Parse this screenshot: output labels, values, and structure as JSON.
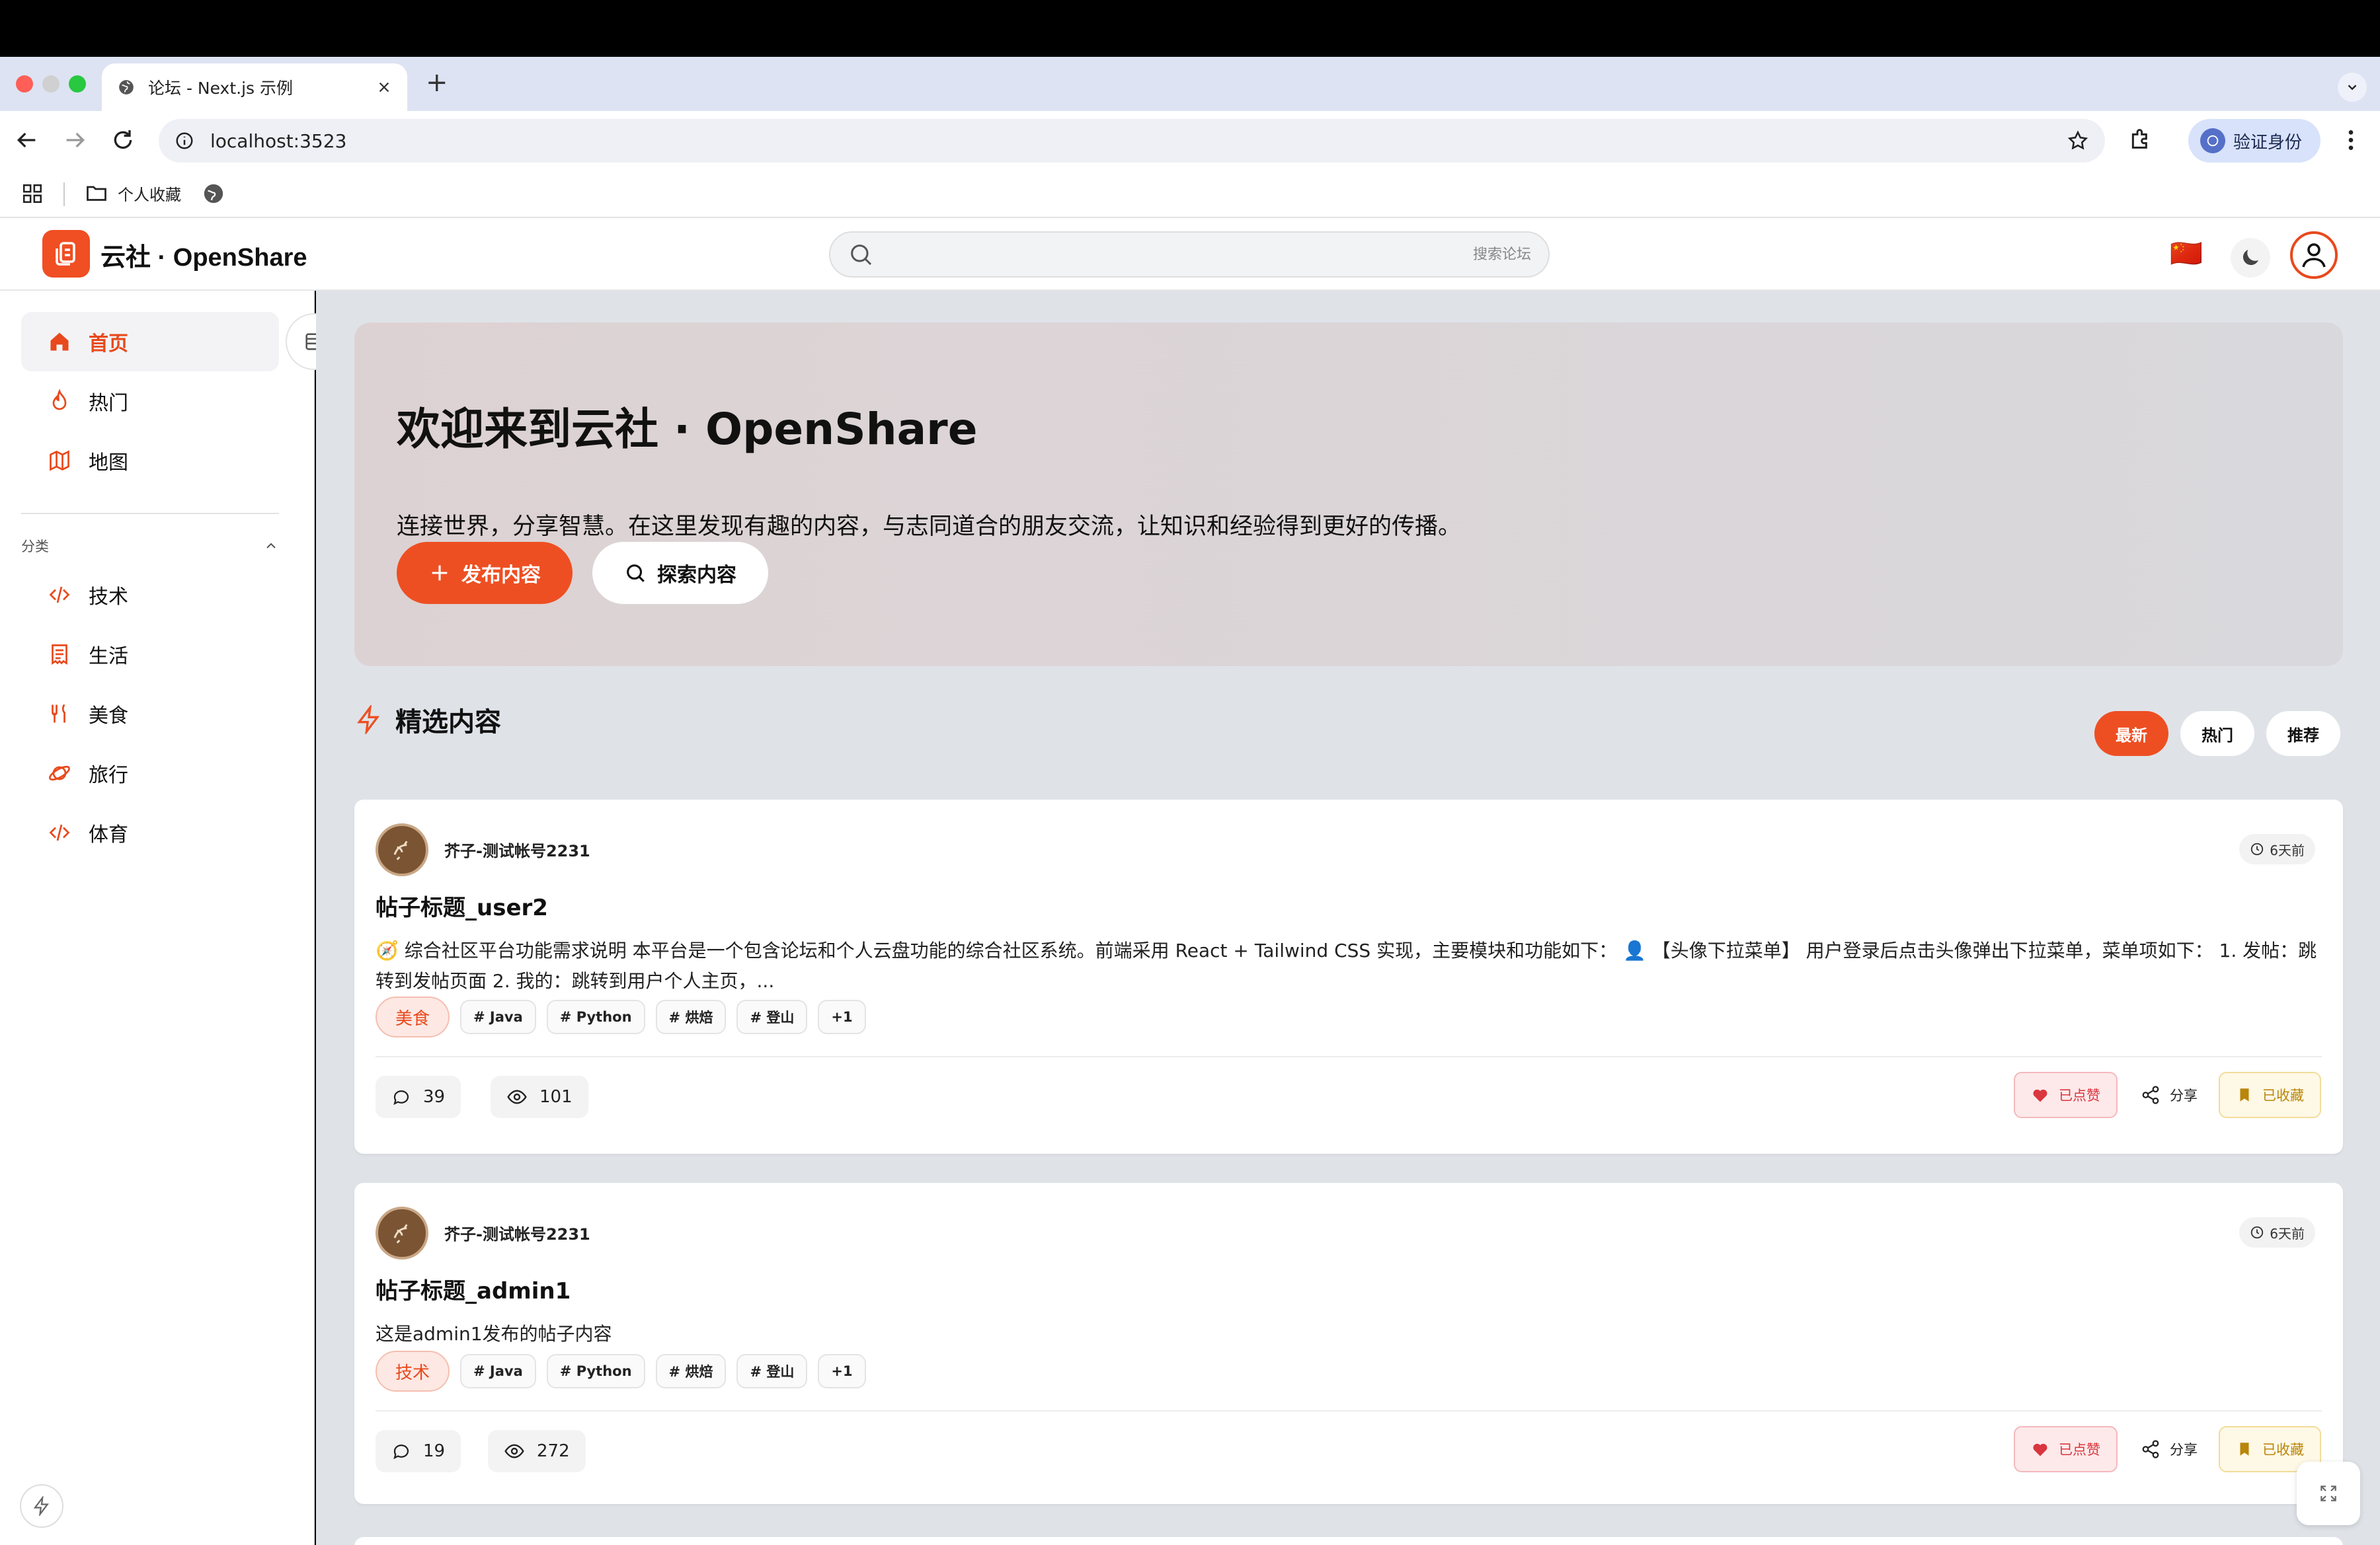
{
  "browser": {
    "tab_title": "论坛 - Next.js 示例",
    "new_tab": "+",
    "url": "localhost:3523",
    "verify_label": "验证身份",
    "bookmark_folder": "个人收藏"
  },
  "header": {
    "brand": "云社 · OpenShare",
    "search_placeholder": "搜索论坛",
    "language_flag": "🇨🇳"
  },
  "sidebar": {
    "nav": [
      {
        "label": "首页",
        "icon": "home-icon"
      },
      {
        "label": "热门",
        "icon": "flame-icon"
      },
      {
        "label": "地图",
        "icon": "map-icon"
      }
    ],
    "section_title": "分类",
    "categories": [
      {
        "label": "技术",
        "icon": "code-icon"
      },
      {
        "label": "生活",
        "icon": "receipt-icon"
      },
      {
        "label": "美食",
        "icon": "utensils-icon"
      },
      {
        "label": "旅行",
        "icon": "planet-icon"
      },
      {
        "label": "体育",
        "icon": "code-icon"
      }
    ]
  },
  "hero": {
    "title": "欢迎来到云社 · OpenShare",
    "subtitle": "连接世界，分享智慧。在这里发现有趣的内容，与志同道合的朋友交流，让知识和经验得到更好的传播。",
    "publish_label": "发布内容",
    "explore_label": "探索内容"
  },
  "featured": {
    "title": "精选内容",
    "sort": [
      "最新",
      "热门",
      "推荐"
    ],
    "accent": "#ee4f22"
  },
  "posts": [
    {
      "author": "芥子-测试帐号2231",
      "time": "6天前",
      "title": "帖子标题_user2",
      "body": "🧭 综合社区平台功能需求说明 本平台是一个包含论坛和个人云盘功能的综合社区系统。前端采用 React + Tailwind CSS 实现，主要模块和功能如下： 👤 【头像下拉菜单】 用户登录后点击头像弹出下拉菜单，菜单项如下： 1. 发帖：跳转到发帖页面 2. 我的：跳转到用户个人主页，...",
      "category": "美食",
      "tags": [
        "# Java",
        "# Python",
        "# 烘焙",
        "# 登山",
        "+1"
      ],
      "comments": "39",
      "views": "101",
      "liked_label": "已点赞",
      "share_label": "分享",
      "saved_label": "已收藏"
    },
    {
      "author": "芥子-测试帐号2231",
      "time": "6天前",
      "title": "帖子标题_admin1",
      "body": "这是admin1发布的帖子内容",
      "category": "技术",
      "tags": [
        "# Java",
        "# Python",
        "# 烘焙",
        "# 登山",
        "+1"
      ],
      "comments": "19",
      "views": "272",
      "liked_label": "已点赞",
      "share_label": "分享",
      "saved_label": "已收藏"
    }
  ]
}
